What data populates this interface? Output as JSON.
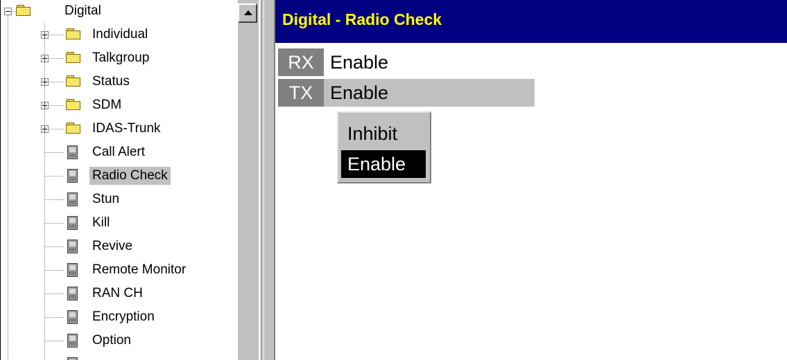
{
  "tree": {
    "items": [
      {
        "label": "Digital",
        "kind": "folder",
        "expander": "minus",
        "level": 0
      },
      {
        "label": "Individual",
        "kind": "folder",
        "expander": "plus",
        "level": 1
      },
      {
        "label": "Talkgroup",
        "kind": "folder",
        "expander": "plus",
        "level": 1
      },
      {
        "label": "Status",
        "kind": "folder",
        "expander": "plus",
        "level": 1
      },
      {
        "label": "SDM",
        "kind": "folder",
        "expander": "plus",
        "level": 1
      },
      {
        "label": "IDAS-Trunk",
        "kind": "folder",
        "expander": "plus",
        "level": 1
      },
      {
        "label": "Call Alert",
        "kind": "item",
        "level": 1
      },
      {
        "label": "Radio Check",
        "kind": "item",
        "level": 1,
        "selected": true
      },
      {
        "label": "Stun",
        "kind": "item",
        "level": 1
      },
      {
        "label": "Kill",
        "kind": "item",
        "level": 1
      },
      {
        "label": "Revive",
        "kind": "item",
        "level": 1
      },
      {
        "label": "Remote Monitor",
        "kind": "item",
        "level": 1
      },
      {
        "label": "RAN CH",
        "kind": "item",
        "level": 1
      },
      {
        "label": "Encryption",
        "kind": "item",
        "level": 1
      },
      {
        "label": "Option",
        "kind": "item",
        "level": 1
      },
      {
        "label": "",
        "kind": "item",
        "level": 1
      }
    ]
  },
  "content": {
    "title": "Digital - Radio Check",
    "rows": [
      {
        "tag": "RX",
        "value": "Enable"
      },
      {
        "tag": "TX",
        "value": "Enable"
      }
    ],
    "dropdown": {
      "options": [
        "Inhibit",
        "Enable"
      ],
      "selected": "Enable"
    }
  },
  "colors": {
    "title_bar": "#000080",
    "title_text": "#ffff00",
    "selection": "#000000",
    "tag_bg": "#808080"
  }
}
